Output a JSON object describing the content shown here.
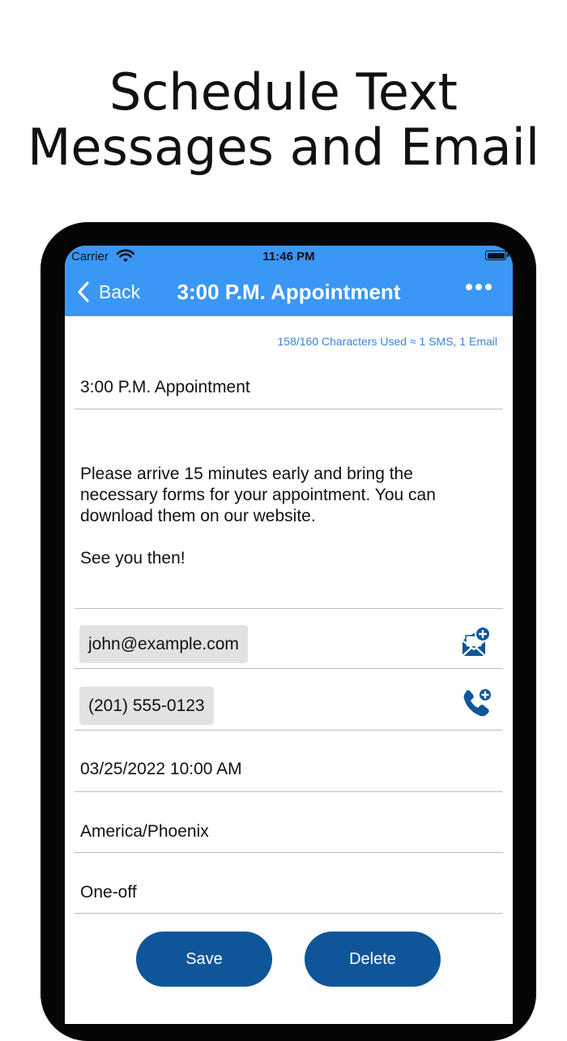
{
  "promo": {
    "title_line1": "Schedule Text",
    "title_line2": "Messages and Email"
  },
  "status_bar": {
    "carrier": "Carrier",
    "time": "11:46 PM"
  },
  "nav": {
    "back_label": "Back",
    "title": "3:00 P.M. Appointment"
  },
  "message": {
    "counter": "158/160 Characters Used ≈ 1 SMS, 1 Email",
    "subject": "3:00 P.M. Appointment",
    "body_line1": "Please arrive 15 minutes early and bring the necessary forms for your appointment. You can download them on our website.",
    "body_line2": "See you then!"
  },
  "recipients": {
    "email": "john@example.com",
    "phone": "(201) 555-0123"
  },
  "schedule": {
    "datetime": "03/25/2022 10:00 AM",
    "timezone": "America/Phoenix",
    "repeat": "One-off"
  },
  "actions": {
    "save_label": "Save",
    "delete_label": "Delete"
  },
  "colors": {
    "accent": "#3a97f5",
    "button": "#0e559a",
    "icon": "#0e559a",
    "counter_text": "#3a82dd"
  },
  "icons": [
    "wifi-icon",
    "battery-icon",
    "back-chevron-icon",
    "more-icon",
    "add-email-icon",
    "add-phone-icon"
  ]
}
